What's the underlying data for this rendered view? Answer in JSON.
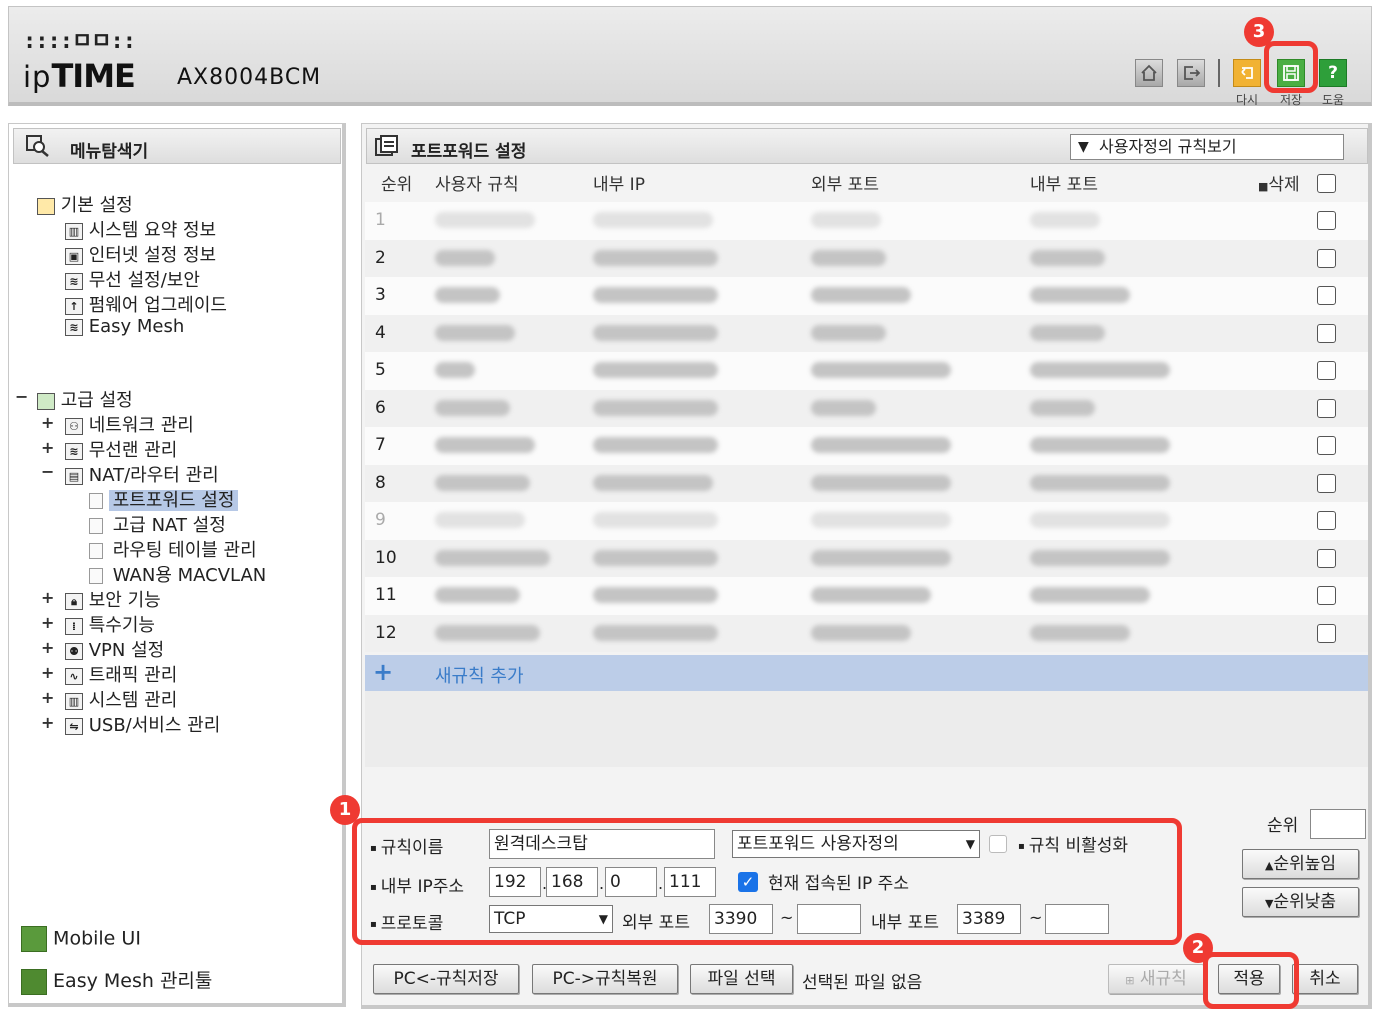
{
  "header": {
    "brand_small": "::::ㅁㅁ::",
    "brand_name_left": "ip",
    "brand_name_bold": "TIME",
    "model": "AX8004BCM",
    "buttons": {
      "restart_label": "다시",
      "save_label": "저장",
      "help_label": "도움"
    }
  },
  "sidebar": {
    "title": "메뉴탐색기",
    "basic": {
      "label": "기본 설정",
      "items": [
        "시스템 요약 정보",
        "인터넷 설정 정보",
        "무선 설정/보안",
        "펌웨어 업그레이드",
        "Easy Mesh"
      ]
    },
    "advanced": {
      "label": "고급 설정",
      "network": "네트워크 관리",
      "wireless": "무선랜 관리",
      "nat": "NAT/라우터 관리",
      "nat_items": [
        "포트포워드 설정",
        "고급 NAT 설정",
        "라우팅 테이블 관리",
        "WAN용 MACVLAN"
      ],
      "others": [
        "보안 기능",
        "특수기능",
        "VPN 설정",
        "트래픽 관리",
        "시스템 관리",
        "USB/서비스 관리"
      ]
    },
    "footer": {
      "mobile_ui": "Mobile UI",
      "mesh_tool": "Easy Mesh 관리툴"
    }
  },
  "content": {
    "title": "포트포워드 설정",
    "view_select": "사용자정의 규칙보기",
    "table": {
      "headers": {
        "order": "순위",
        "rule": "사용자 규칙",
        "internal_ip": "내부 IP",
        "external_port": "외부 포트",
        "internal_port": "내부 포트",
        "delete": "삭제"
      },
      "rows": [
        "1",
        "2",
        "3",
        "4",
        "5",
        "6",
        "7",
        "8",
        "9",
        "10",
        "11",
        "12"
      ],
      "add_rule": "새규칙 추가"
    },
    "form": {
      "rule_name_label": "규칙이름",
      "rule_name_value": "원격데스크탑",
      "preset_value": "포트포워드 사용자정의",
      "disable_label": "규칙 비활성화",
      "ip_label": "내부 IP주소",
      "ip": [
        "192",
        "168",
        "0",
        "111"
      ],
      "current_ip_label": "현재 접속된 IP 주소",
      "protocol_label": "프로토콜",
      "protocol_value": "TCP",
      "ext_port_label": "외부 포트",
      "ext_port_from": "3390",
      "int_port_label": "내부 포트",
      "int_port_from": "3389",
      "tilde": "~"
    },
    "order": {
      "label": "순위",
      "up": "순위높임",
      "down": "순위낮춤"
    },
    "buttons": {
      "backup": "PC<-규칙저장",
      "restore": "PC->규칙복원",
      "choose_file": "파일 선택",
      "no_file": "선택된 파일 없음",
      "new_rule": "새규칙",
      "apply": "적용",
      "cancel": "취소"
    }
  },
  "annotations": [
    "1",
    "2",
    "3"
  ],
  "colors": {
    "accent_red": "#ef3a32",
    "selected_tree": "#b6c8e6",
    "add_row": "#bccde8",
    "link_blue": "#3a7cc9"
  }
}
